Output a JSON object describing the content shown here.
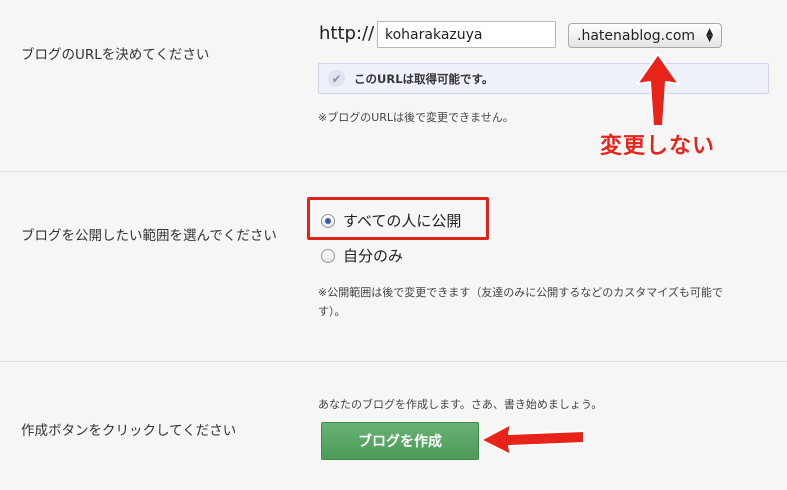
{
  "sections": {
    "url": {
      "label": "ブログのURLを決めてください",
      "prefix": "http://",
      "subdomain_value": "koharakazuya",
      "domain_selected": ".hatenablog.com",
      "availability": "このURLは取得可能です。",
      "note": "※ブログのURLは後で変更できません。"
    },
    "visibility": {
      "label": "ブログを公開したい範囲を選んでください",
      "options": [
        {
          "label": "すべての人に公開",
          "checked": true
        },
        {
          "label": "自分のみ",
          "checked": false
        }
      ],
      "note_line1": "※公開範囲は後で変更できます（友達のみに公開するなどのカスタマイズも可能で",
      "note_line2": "す）。"
    },
    "create": {
      "label": "作成ボタンをクリックしてください",
      "intro": "あなたのブログを作成します。さあ、書き始めましょう。",
      "button_label": "ブログを作成"
    }
  },
  "annotations": {
    "no_change_text": "変更しない",
    "accent_color": "#e8231a"
  },
  "icons": {
    "check": "check-icon",
    "select_arrows": "select-arrows-icon",
    "arrow_up": "red-arrow-up",
    "arrow_left": "red-arrow-left"
  }
}
